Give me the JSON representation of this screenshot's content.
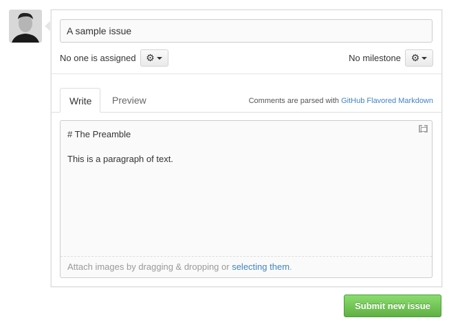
{
  "issue": {
    "title_value": "A sample issue",
    "assignee_text": "No one is assigned",
    "milestone_text": "No milestone"
  },
  "tabs": [
    {
      "label": "Write",
      "active": true
    },
    {
      "label": "Preview",
      "active": false
    }
  ],
  "hint": {
    "prefix": "Comments are parsed with ",
    "link": "GitHub Flavored Markdown"
  },
  "body_value": "# The Preamble\n\nThis is a paragraph of text.",
  "attach": {
    "prefix": "Attach images by dragging & dropping or ",
    "link": "selecting them",
    "suffix": "."
  },
  "submit_label": "Submit new issue",
  "colors": {
    "link": "#4183c4",
    "submit": "#60b044"
  }
}
